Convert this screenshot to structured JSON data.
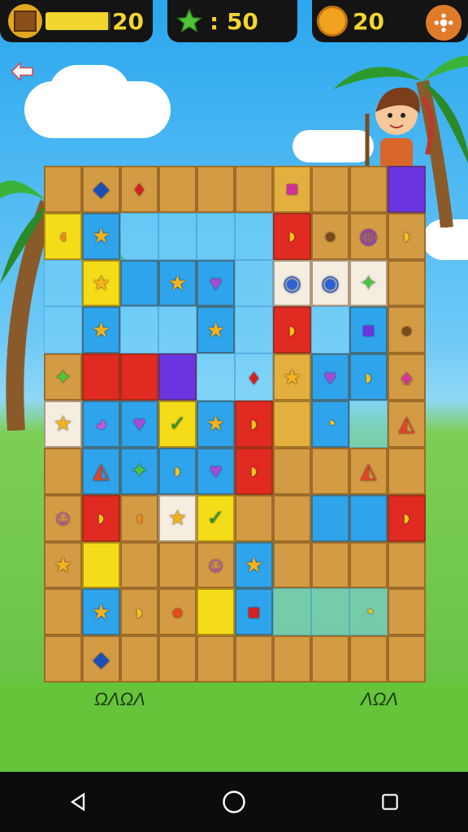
{
  "hud": {
    "level_value": "20",
    "stars_value": ": 50",
    "coins_value": "20",
    "level_bar_fraction": 0.62
  },
  "icons": {
    "back": "back-arrow-icon",
    "settings": "settings-gear-icon",
    "crate": "crate-level-icon",
    "star": "star-icon",
    "coin": "coin-icon"
  },
  "footer_marks": {
    "left": "ΩΛΩΛ",
    "right": "ΛΩΛ"
  },
  "colors": {
    "brown_tile": "#d39b43",
    "gold_tile": "#e3b040",
    "blue_tile": "#2ea4ec",
    "red_tile": "#e02a22",
    "yellow_tile": "#f5dc19",
    "green_tile": "#35b63a",
    "purple_tile": "#6a35e0",
    "hud_text": "#f2d52e"
  },
  "board": {
    "rows": [
      [
        "B:",
        "B:fish",
        "B:pepper",
        "B:",
        "B:",
        "B:",
        "G:m",
        "B:",
        "B:",
        "P:"
      ],
      [
        "Y:carrot",
        "L:star",
        "E:",
        "E:",
        "E:",
        "E:",
        "R:banana",
        "B:nut",
        "B:pot",
        "B:banana"
      ],
      [
        "E:",
        "Y:star",
        "L:",
        "L:star",
        "L:heart",
        "E:",
        "W:blob",
        "W:blob",
        "W:frog",
        "B:"
      ],
      [
        "E:",
        "L:star",
        "E:",
        "E:",
        "L:star",
        "E:",
        "R:banana",
        "E:",
        "L:p",
        "B:nut"
      ],
      [
        "B:frog",
        "R:",
        "R:",
        "P:",
        "E:",
        "E:pepper",
        "G:star",
        "L:heart",
        "L:banana",
        "B:shell"
      ],
      [
        "W:star",
        "L:pig",
        "L:heart",
        "Y:check",
        "L:star",
        "R:banana",
        "G:",
        "L:chick",
        "E:",
        "B:bird"
      ],
      [
        "B:",
        "L:bird",
        "L:frog",
        "L:banana",
        "L:heart",
        "R:banana",
        "B:",
        "B:",
        "B:bird",
        "B:"
      ],
      [
        "B:purple",
        "R:banana",
        "B:carrot",
        "W:star",
        "Y:check",
        "B:",
        "B:",
        "L:",
        "L:",
        "R:banana"
      ],
      [
        "B:star",
        "Y:",
        "B:",
        "B:",
        "B:purple",
        "L:star",
        "B:",
        "B:",
        "B:",
        "B:"
      ],
      [
        "B:",
        "L:star",
        "B:banana",
        "B:tomato",
        "Y:",
        "L:red",
        "E:",
        "E:",
        "E:chick",
        "B:"
      ],
      [
        "B:",
        "B:fish",
        "B:",
        "B:",
        "B:",
        "B:",
        "B:",
        "B:",
        "B:",
        "B:"
      ]
    ]
  }
}
